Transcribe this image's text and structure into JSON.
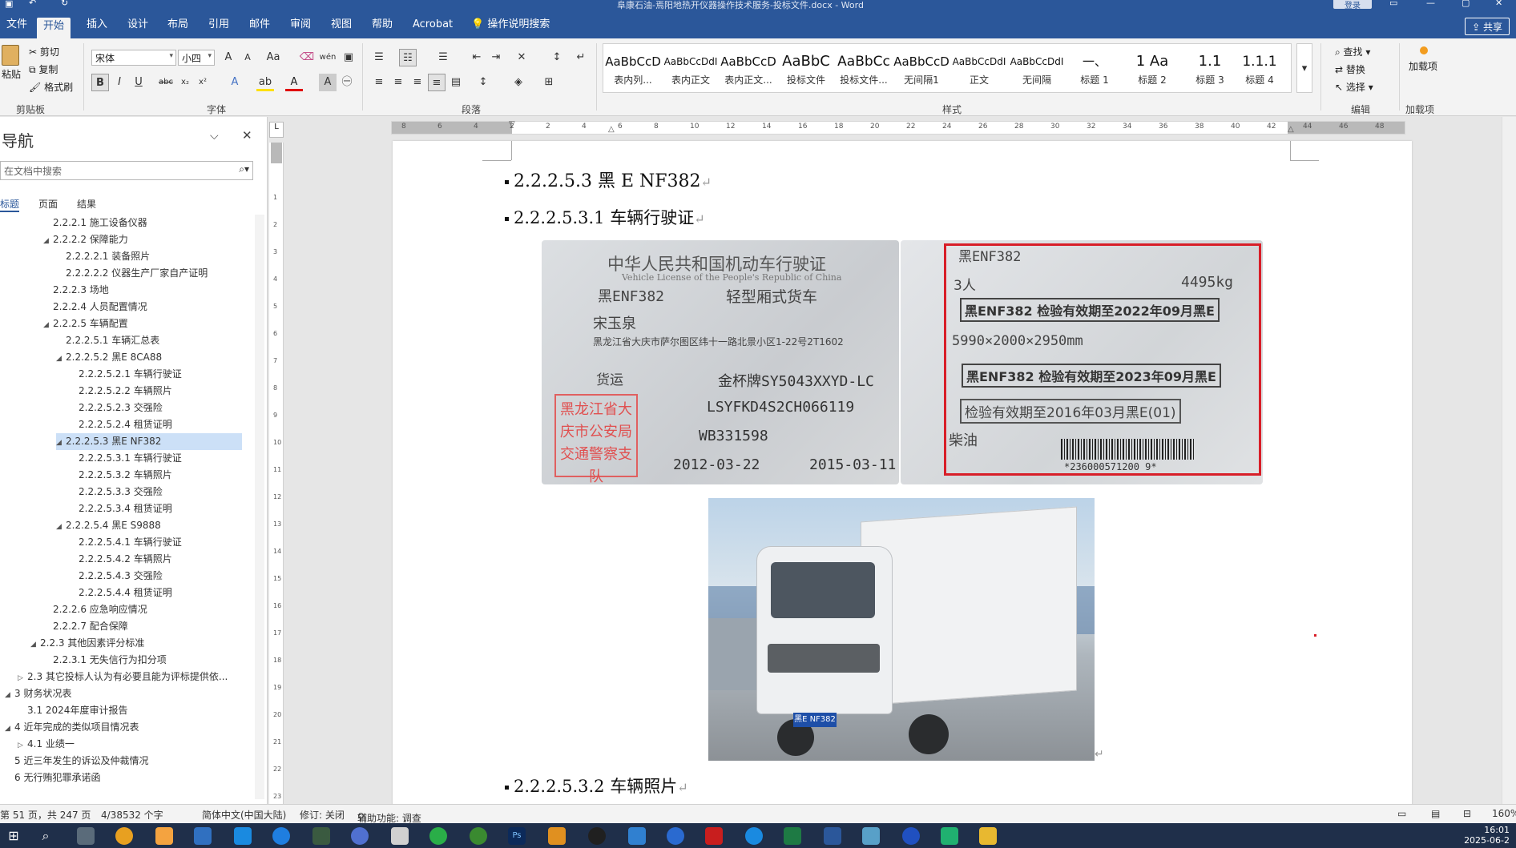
{
  "window": {
    "title": "阜康石油-焉阳地热开仪器操作技术服务-投标文件.docx - Word",
    "login_label": "登录"
  },
  "tabs": [
    "文件",
    "开始",
    "插入",
    "设计",
    "布局",
    "引用",
    "邮件",
    "审阅",
    "视图",
    "帮助",
    "Acrobat",
    "操作说明搜索"
  ],
  "share_label": "共享",
  "ribbon": {
    "clipboard": {
      "paste": "粘贴",
      "cut": "剪切",
      "copy": "复制",
      "format_painter": "格式刷",
      "label": "剪贴板"
    },
    "font": {
      "name": "宋体",
      "size": "小四",
      "label": "字体"
    },
    "paragraph": {
      "label": "段落"
    },
    "styles": {
      "label": "样式",
      "items": [
        {
          "sample": "AaBbCcD",
          "name": "表内列..."
        },
        {
          "sample": "AaBbCcDdI",
          "name": "表内正文"
        },
        {
          "sample": "AaBbCcD",
          "name": "表内正文..."
        },
        {
          "sample": "AaBbC",
          "name": "投标文件"
        },
        {
          "sample": "AaBbCc",
          "name": "投标文件..."
        },
        {
          "sample": "AaBbCcD",
          "name": "无间隔1"
        },
        {
          "sample": "AaBbCcDdI",
          "name": "正文"
        },
        {
          "sample": "AaBbCcDdI",
          "name": "无间隔"
        },
        {
          "sample": "一、",
          "name": "标题 1"
        },
        {
          "sample": "1 Aa",
          "name": "标题 2"
        },
        {
          "sample": "1.1",
          "name": "标题 3"
        },
        {
          "sample": "1.1.1",
          "name": "标题 4"
        }
      ]
    },
    "editing": {
      "find": "查找",
      "replace": "替换",
      "select": "选择",
      "label": "编辑"
    },
    "addins": {
      "add": "加载项",
      "label": "加载项"
    }
  },
  "nav": {
    "title": "导航",
    "search_placeholder": "在文档中搜索",
    "tabs": [
      "标题",
      "页面",
      "结果"
    ],
    "headings": [
      {
        "text": "2.2.2.1 施工设备仪器",
        "level": 4,
        "tri": ""
      },
      {
        "text": "2.2.2.2 保障能力",
        "level": 4,
        "tri": "◢"
      },
      {
        "text": "2.2.2.2.1 装备照片",
        "level": 5,
        "tri": ""
      },
      {
        "text": "2.2.2.2.2 仪器生产厂家自产证明",
        "level": 5,
        "tri": ""
      },
      {
        "text": "2.2.2.3 场地",
        "level": 4,
        "tri": ""
      },
      {
        "text": "2.2.2.4 人员配置情况",
        "level": 4,
        "tri": ""
      },
      {
        "text": "2.2.2.5 车辆配置",
        "level": 4,
        "tri": "◢"
      },
      {
        "text": "2.2.2.5.1 车辆汇总表",
        "level": 5,
        "tri": ""
      },
      {
        "text": "2.2.2.5.2 黑E 8CA88",
        "level": 5,
        "tri": "◢"
      },
      {
        "text": "2.2.2.5.2.1 车辆行驶证",
        "level": 6,
        "tri": ""
      },
      {
        "text": "2.2.2.5.2.2 车辆照片",
        "level": 6,
        "tri": ""
      },
      {
        "text": "2.2.2.5.2.3 交强险",
        "level": 6,
        "tri": ""
      },
      {
        "text": "2.2.2.5.2.4 租赁证明",
        "level": 6,
        "tri": ""
      },
      {
        "text": "2.2.2.5.3 黑E NF382",
        "level": 5,
        "tri": "◢",
        "selected": true
      },
      {
        "text": "2.2.2.5.3.1 车辆行驶证",
        "level": 6,
        "tri": ""
      },
      {
        "text": "2.2.2.5.3.2 车辆照片",
        "level": 6,
        "tri": ""
      },
      {
        "text": "2.2.2.5.3.3 交强险",
        "level": 6,
        "tri": ""
      },
      {
        "text": "2.2.2.5.3.4 租赁证明",
        "level": 6,
        "tri": ""
      },
      {
        "text": "2.2.2.5.4 黑E S9888",
        "level": 5,
        "tri": "◢"
      },
      {
        "text": "2.2.2.5.4.1 车辆行驶证",
        "level": 6,
        "tri": ""
      },
      {
        "text": "2.2.2.5.4.2 车辆照片",
        "level": 6,
        "tri": ""
      },
      {
        "text": "2.2.2.5.4.3 交强险",
        "level": 6,
        "tri": ""
      },
      {
        "text": "2.2.2.5.4.4 租赁证明",
        "level": 6,
        "tri": ""
      },
      {
        "text": "2.2.2.6 应急响应情况",
        "level": 4,
        "tri": ""
      },
      {
        "text": "2.2.2.7 配合保障",
        "level": 4,
        "tri": ""
      },
      {
        "text": "2.2.3 其他因素评分标准",
        "level": 3,
        "tri": "◢"
      },
      {
        "text": "2.2.3.1 无失信行为扣分项",
        "level": 4,
        "tri": ""
      },
      {
        "text": "2.3 其它投标人认为有必要且能为评标提供依...",
        "level": 2,
        "tri": "▷"
      },
      {
        "text": "3 财务状况表",
        "level": 1,
        "tri": "◢"
      },
      {
        "text": "3.1 2024年度审计报告",
        "level": 2,
        "tri": ""
      },
      {
        "text": "4 近年完成的类似项目情况表",
        "level": 1,
        "tri": "◢"
      },
      {
        "text": "4.1 业绩一",
        "level": 2,
        "tri": "▷"
      },
      {
        "text": "5 近三年发生的诉讼及仲裁情况",
        "level": 1,
        "tri": ""
      },
      {
        "text": "6 无行贿犯罪承诺函",
        "level": 1,
        "tri": ""
      }
    ]
  },
  "document": {
    "heading1": "2.2.2.5.3 黑 E NF382",
    "heading2": "2.2.2.5.3.1 车辆行驶证",
    "heading3": "2.2.2.5.3.2 车辆照片",
    "license_front": {
      "title_cn": "中华人民共和国机动车行驶证",
      "title_en": "Vehicle License of the People's Republic of China",
      "plate": "黑ENF382",
      "vehicle_type": "轻型厢式货车",
      "owner": "宋玉泉",
      "address": "黑龙江省大庆市萨尔图区纬十一路北景小区1-22号2T1602",
      "use": "货运",
      "model": "金杯牌SY5043XXYD-LC",
      "vin": "LSYFKD4S2CH066119",
      "engine": "WB331598",
      "register_date": "2012-03-22",
      "issue_date": "2015-03-11",
      "stamp": "黑龙江省大庆市公安局交通警察支队"
    },
    "license_back": {
      "plate": "黑ENF382",
      "persons": "3人",
      "weight": "4495kg",
      "dims": "5990×2000×2950mm",
      "inspect1": "黑ENF382 检验有效期至2022年09月黑E",
      "inspect2": "黑ENF382 检验有效期至2023年09月黑E",
      "inspect3": "检验有效期至2016年03月黑E(01)",
      "fuel": "柴油",
      "barcode": "*236000571200 9*"
    },
    "truck_plate": "黑E NF382"
  },
  "status": {
    "page": "第 51 页，共 247 页",
    "words": "4/38532 个字",
    "lang": "简体中文(中国大陆)",
    "track": "修订: 关闭",
    "access": "辅助功能: 调查",
    "zoom": "160%"
  },
  "clock": {
    "time": "16:01",
    "date": "2025-06-2"
  },
  "colors": {
    "accent": "#2b579a",
    "highlight": "#d81e28"
  }
}
